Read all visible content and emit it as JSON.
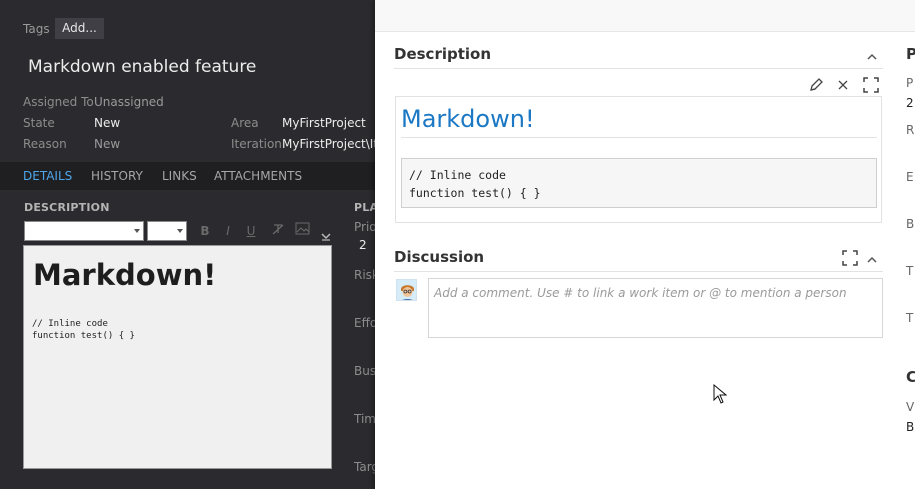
{
  "work_item": {
    "tags_label": "Tags",
    "add_tag_label": "Add...",
    "title": "Markdown enabled feature",
    "fields": {
      "assigned_to_label": "Assigned To",
      "assigned_to_value": "Unassigned",
      "state_label": "State",
      "state_value": "New",
      "reason_label": "Reason",
      "reason_value": "New",
      "area_label": "Area",
      "area_value": "MyFirstProject",
      "iteration_label": "Iteration",
      "iteration_value": "MyFirstProject\\Ite"
    },
    "tabs": [
      "DETAILS",
      "HISTORY",
      "LINKS",
      "ATTACHMENTS"
    ],
    "active_tab": "DETAILS",
    "description_header": "DESCRIPTION",
    "planning_header": "PLA",
    "planning_fields": {
      "priority_label": "Prio",
      "priority_value": "2",
      "risk_label": "Risk",
      "effort_label": "Effo",
      "business_label": "Bus",
      "time_label": "Tim",
      "target_label": "Targ"
    },
    "editor": {
      "heading": "Markdown!",
      "code_line_1": "// Inline code",
      "code_line_2": "function test() { }",
      "toolbar_icons": [
        "bold-icon",
        "italic-icon",
        "underline-icon",
        "clear-format-icon",
        "image-icon",
        "more-icon"
      ],
      "bold_glyph": "B",
      "italic_glyph": "I",
      "underline_glyph": "U"
    }
  },
  "panel": {
    "description_title": "Description",
    "markdown_heading": "Markdown!",
    "code_line_1": "// Inline code",
    "code_line_2": "function test() { }",
    "discussion_title": "Discussion",
    "comment_placeholder": "Add a comment. Use # to link a work item or @ to mention a person",
    "right_fields": {
      "section_head": "P",
      "pr_label": "P",
      "pr_value": "2",
      "r_label": "R",
      "e_label": "E",
      "b_label": "B",
      "t_label": "T",
      "ta_label": "T",
      "c_head": "C",
      "v_label": "V",
      "b_value": "B"
    }
  },
  "colors": {
    "dark_bg": "#2b2b2f",
    "active_tab": "#4ea6ea",
    "markdown_heading": "#1b78c4"
  }
}
